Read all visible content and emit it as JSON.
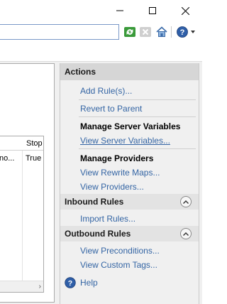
{
  "window": {
    "minimize_icon": "minimize-icon",
    "maximize_icon": "maximize-icon",
    "close_icon": "close-icon"
  },
  "toolbar": {
    "icons": [
      "refresh-icon",
      "stop-icon",
      "home-icon",
      "help-dropdown-icon"
    ]
  },
  "grid": {
    "header_stop": "Stop",
    "row1_col1": "no...",
    "row1_col2": "True"
  },
  "actions": {
    "title": "Actions",
    "add_rules": "Add Rule(s)...",
    "revert_to_parent": "Revert to Parent",
    "manage_server_variables": "Manage Server Variables",
    "view_server_variables": "View Server Variables...",
    "manage_providers": "Manage Providers",
    "view_rewrite_maps": "View Rewrite Maps...",
    "view_providers": "View Providers...",
    "inbound_rules": "Inbound Rules",
    "import_rules": "Import Rules...",
    "outbound_rules": "Outbound Rules",
    "view_preconditions": "View Preconditions...",
    "view_custom_tags": "View Custom Tags...",
    "help": "Help"
  },
  "colors": {
    "link": "#3465a4",
    "header_bg": "#d6d6d6",
    "pane_bg": "#f0f0f0"
  }
}
